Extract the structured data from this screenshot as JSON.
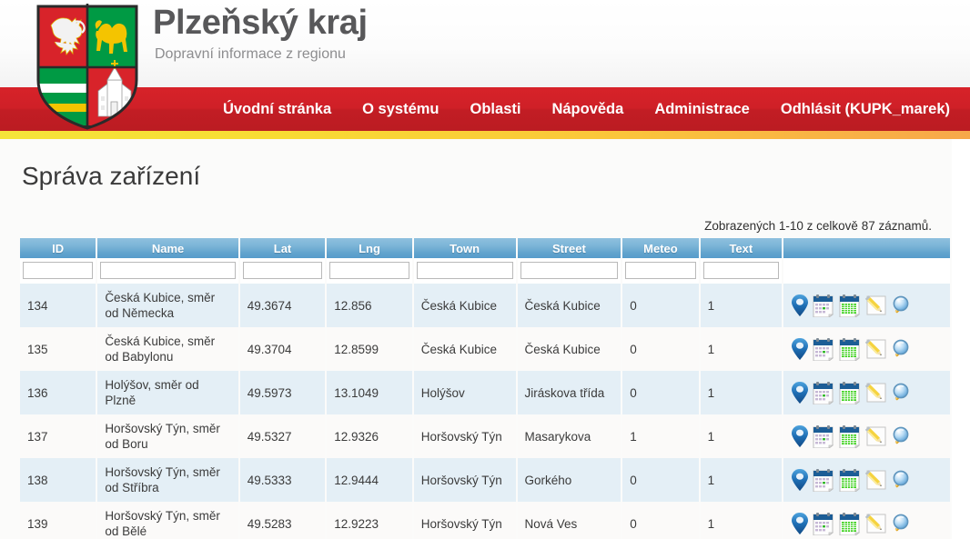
{
  "header": {
    "brand_title": "Plzeňský kraj",
    "brand_subtitle": "Dopravní informace z regionu",
    "crest_icon": "plzen-coat-of-arms-icon"
  },
  "nav": {
    "items": [
      {
        "label": "Úvodní stránka"
      },
      {
        "label": "O systému"
      },
      {
        "label": "Oblasti"
      },
      {
        "label": "Nápověda"
      },
      {
        "label": "Administrace"
      },
      {
        "label": "Odhlásit (KUPK_marek)"
      }
    ]
  },
  "main": {
    "page_title": "Správa zařízení",
    "record_info": "Zobrazených 1-10 z celkově 87 záznamů."
  },
  "table": {
    "columns": [
      {
        "key": "id",
        "label": "ID"
      },
      {
        "key": "name",
        "label": "Name"
      },
      {
        "key": "lat",
        "label": "Lat"
      },
      {
        "key": "lng",
        "label": "Lng"
      },
      {
        "key": "town",
        "label": "Town"
      },
      {
        "key": "street",
        "label": "Street"
      },
      {
        "key": "meteo",
        "label": "Meteo"
      },
      {
        "key": "text",
        "label": "Text"
      },
      {
        "key": "actions",
        "label": ""
      }
    ],
    "filters": {
      "id": "",
      "name": "",
      "lat": "",
      "lng": "",
      "town": "",
      "street": "",
      "meteo": "",
      "text": ""
    },
    "action_icons": [
      {
        "name": "map-marker-icon"
      },
      {
        "name": "calendar-day-icon"
      },
      {
        "name": "calendar-grid-icon"
      },
      {
        "name": "edit-pencil-icon"
      },
      {
        "name": "magnifier-detail-icon"
      }
    ],
    "rows": [
      {
        "id": "134",
        "name": "Česká Kubice, směr od Německa",
        "lat": "49.3674",
        "lng": "12.856",
        "town": "Česká Kubice",
        "street": "Česká Kubice",
        "meteo": "0",
        "text": "1"
      },
      {
        "id": "135",
        "name": "Česká Kubice, směr od Babylonu",
        "lat": "49.3704",
        "lng": "12.8599",
        "town": "Česká Kubice",
        "street": "Česká Kubice",
        "meteo": "0",
        "text": "1"
      },
      {
        "id": "136",
        "name": "Holýšov, směr od Plzně",
        "lat": "49.5973",
        "lng": "13.1049",
        "town": "Holýšov",
        "street": "Jiráskova třída",
        "meteo": "0",
        "text": "1"
      },
      {
        "id": "137",
        "name": "Horšovský Týn, směr od Boru",
        "lat": "49.5327",
        "lng": "12.9326",
        "town": "Horšovský Týn",
        "street": "Masarykova",
        "meteo": "1",
        "text": "1"
      },
      {
        "id": "138",
        "name": "Horšovský Týn, směr od Stříbra",
        "lat": "49.5333",
        "lng": "12.9444",
        "town": "Horšovský Týn",
        "street": "Gorkého",
        "meteo": "0",
        "text": "1"
      },
      {
        "id": "139",
        "name": "Horšovský Týn, směr od Bělé",
        "lat": "49.5283",
        "lng": "12.9223",
        "town": "Horšovský Týn",
        "street": "Nová Ves",
        "meteo": "0",
        "text": "1"
      }
    ]
  },
  "colors": {
    "nav_red": "#cc2027",
    "accent_yellow": "#f5e43a",
    "accent_orange": "#f7a84a",
    "header_blue": "#6ca9cf",
    "row_odd": "#e4eff6",
    "row_even": "#fbfaf9",
    "title_gray": "#58585a"
  }
}
